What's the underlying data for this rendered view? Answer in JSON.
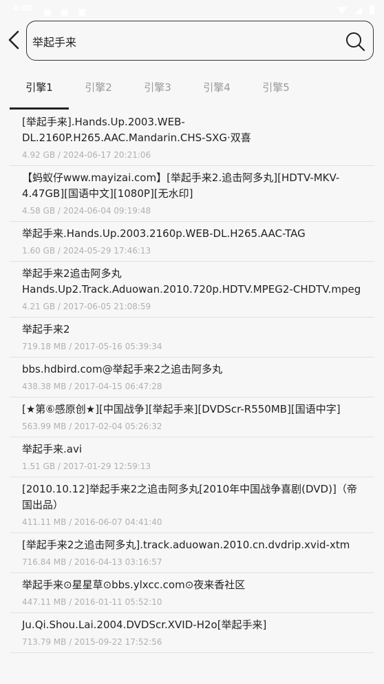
{
  "status_bar": {
    "time": "4:00"
  },
  "search": {
    "query": "举起手来"
  },
  "tabs": [
    "引擎1",
    "引擎2",
    "引擎3",
    "引擎4",
    "引擎5"
  ],
  "results": [
    {
      "title": "[举起手来].Hands.Up.2003.WEB-DL.2160P.H265.AAC.Mandarin.CHS-SXG·双喜",
      "meta": "4.92 GB / 2024-06-17 20:21:06"
    },
    {
      "title": "【蚂蚁仔www.mayizai.com】[举起手来2.追击阿多丸][HDTV-MKV-4.47GB][国语中文][1080P][无水印]",
      "meta": "4.58 GB / 2024-06-04 09:19:48"
    },
    {
      "title": "举起手来.Hands.Up.2003.2160p.WEB-DL.H265.AAC-TAG",
      "meta": "1.60 GB / 2024-05-29 17:46:13"
    },
    {
      "title": "举起手来2追击阿多丸Hands.Up2.Track.Aduowan.2010.720p.HDTV.MPEG2-CHDTV.mpeg",
      "meta": "4.21 GB / 2017-06-05 21:08:59"
    },
    {
      "title": "举起手来2",
      "meta": "719.18 MB / 2017-05-16 05:39:34"
    },
    {
      "title": "bbs.hdbird.com@举起手来2之追击阿多丸",
      "meta": "438.38 MB / 2017-04-15 06:47:28"
    },
    {
      "title": "[★第⑥感原创★][中国战争][举起手来][DVDScr-R550MB][国语中字]",
      "meta": "563.99 MB / 2017-02-04 05:26:32"
    },
    {
      "title": "举起手来.avi",
      "meta": "1.51 GB / 2017-01-29 12:59:13"
    },
    {
      "title": "[2010.10.12]举起手来2之追击阿多丸[2010年中国战争喜剧(DVD)]（帝国出品）",
      "meta": "411.11 MB / 2016-06-07 04:41:40"
    },
    {
      "title": "[举起手来2之追击阿多丸].track.aduowan.2010.cn.dvdrip.xvid-xtm",
      "meta": "716.84 MB / 2016-04-13 03:16:57"
    },
    {
      "title": "举起手来⊙星星草⊙bbs.ylxcc.com⊙夜来香社区",
      "meta": "447.11 MB / 2016-01-11 05:52:10"
    },
    {
      "title": "Ju.Qi.Shou.Lai.2004.DVDScr.XVID-H2o[举起手来]",
      "meta": "713.79 MB / 2015-09-22 17:52:56"
    }
  ]
}
